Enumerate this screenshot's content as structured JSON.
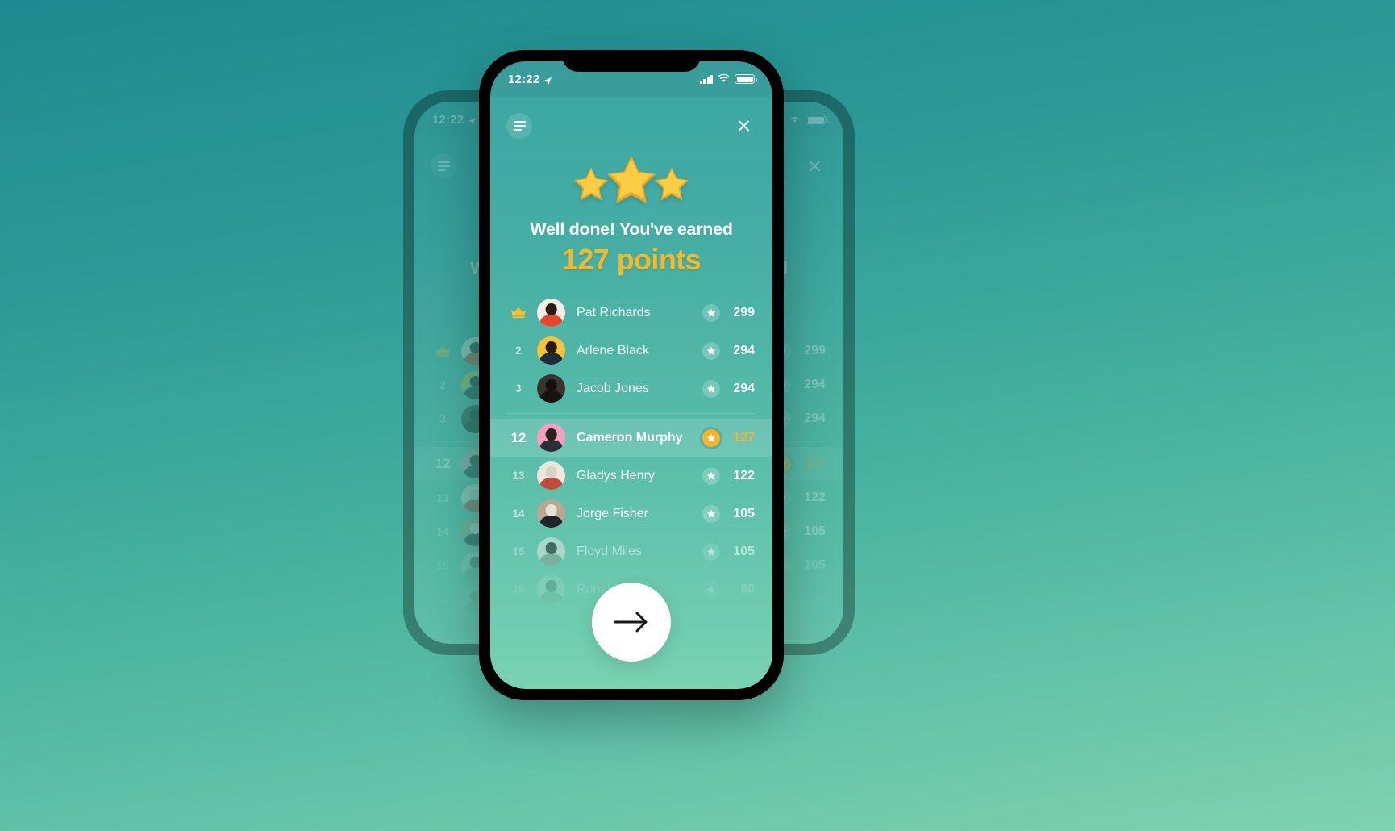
{
  "theme": {
    "bg_gradient_top": "#1e8a8f",
    "bg_gradient_bottom": "#7fd2b0",
    "accent_gold": "#f5b42a",
    "screen_top": "#3aa5a4",
    "screen_bottom": "#79d2b2"
  },
  "status_bar": {
    "time": "12:22",
    "location_icon": "location-arrow-icon",
    "signal_icon": "cellular-signal-icon",
    "wifi_icon": "wifi-icon",
    "battery_icon": "battery-full-icon"
  },
  "top_controls": {
    "menu_icon": "hamburger-menu-icon",
    "close_icon": "close-icon"
  },
  "hero": {
    "stars_icon": "three-stars-icon",
    "headline": "Well done! You've earned",
    "points": "127 points"
  },
  "leaderboard": {
    "star_icon": "star-icon",
    "crown_icon": "crown-icon",
    "top_rows": [
      {
        "rank": "1",
        "crown": true,
        "name": "Pat Richards",
        "score": "299",
        "avatar_hair": "#2b1b16",
        "avatar_body": "#e8452a",
        "avatar_bg": "#f3ece3"
      },
      {
        "rank": "2",
        "crown": false,
        "name": "Arlene Black",
        "score": "294",
        "avatar_hair": "#241a17",
        "avatar_body": "#1d2b3a",
        "avatar_bg": "#f5c23a"
      },
      {
        "rank": "3",
        "crown": false,
        "name": "Jacob Jones",
        "score": "294",
        "avatar_hair": "#14100e",
        "avatar_body": "#161312",
        "avatar_bg": "#3a332e"
      }
    ],
    "bottom_rows": [
      {
        "rank": "12",
        "highlight": true,
        "name": "Cameron Murphy",
        "score": "127",
        "avatar_hair": "#2b211c",
        "avatar_body": "#2a2f36",
        "avatar_bg": "#f49ec0",
        "fade": ""
      },
      {
        "rank": "13",
        "highlight": false,
        "name": "Gladys Henry",
        "score": "122",
        "avatar_hair": "#d8d2ca",
        "avatar_body": "#c14a3a",
        "avatar_bg": "#efe7dd",
        "fade": ""
      },
      {
        "rank": "14",
        "highlight": false,
        "name": "Jorge Fisher",
        "score": "105",
        "avatar_hair": "#e7e1d6",
        "avatar_body": "#20242a",
        "avatar_bg": "#b8a894",
        "fade": ""
      },
      {
        "rank": "15",
        "highlight": false,
        "name": "Floyd Miles",
        "score": "105",
        "avatar_hair": "#2a2622",
        "avatar_body": "#86a49a",
        "avatar_bg": "#dfe9e2",
        "fade": "fade-15"
      },
      {
        "rank": "16",
        "highlight": false,
        "name": "Ronald",
        "score": "90",
        "avatar_hair": "#3a352f",
        "avatar_body": "#7f9b92",
        "avatar_bg": "#d5e2dc",
        "fade": "fade-16"
      }
    ]
  },
  "next_button": {
    "icon": "arrow-right-icon",
    "label": ""
  }
}
